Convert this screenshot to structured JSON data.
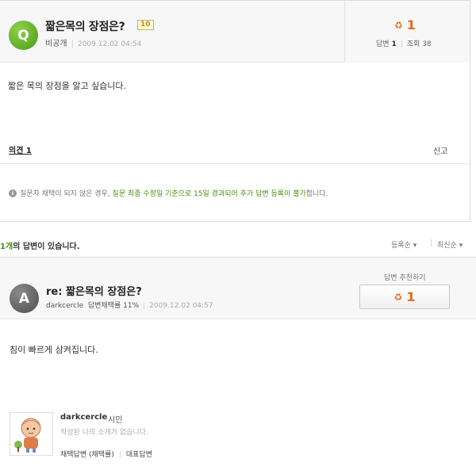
{
  "question": {
    "badge": "Q",
    "title": "짧은목의 장점은?",
    "points": "10",
    "author": "비공개",
    "date": "2009.12.02 04:54",
    "recommend_count": "1",
    "answers_label": "답변",
    "answers_count": "1",
    "views_label": "조회",
    "views_count": "38",
    "body": "짧은 목의 장점을 알고 싶습니다.",
    "opinion_label": "의견 1",
    "report_label": "신고",
    "notice_prefix": "질문자 채택이 되지 않은 경우,",
    "notice_highlight": "질문 최종 수정일 기준으로 15일 경과되어 추가 답변 등록이 불가",
    "notice_suffix": "합니다."
  },
  "answers_header": {
    "count": "1개",
    "text": "의 답변이 있습니다.",
    "sort_registered": "등록순",
    "sort_latest": "최신순"
  },
  "answer": {
    "badge": "A",
    "title": "re: 짧은목의 장점은?",
    "author": "darkcercle",
    "adoption_rate": "답변채택률 11%",
    "date": "2009.12.02 04:57",
    "recommend_label": "답변 추천하기",
    "recommend_count": "1",
    "body": "침이 빠르게 삼켜집니다."
  },
  "profile": {
    "name": "darkcercle",
    "grade": "시민",
    "intro": "작성된 나의 소개가 없습니다.",
    "stat_adopt": "채택답변 (채택률)",
    "stat_rep": "대표답변"
  },
  "colors": {
    "green": "#4b8f0e",
    "orange": "#e56a1e",
    "question_badge": "#6bb52a",
    "answer_badge": "#666666"
  },
  "icons": [
    "thumbs-up-icon",
    "info-icon",
    "caret-down-icon"
  ]
}
